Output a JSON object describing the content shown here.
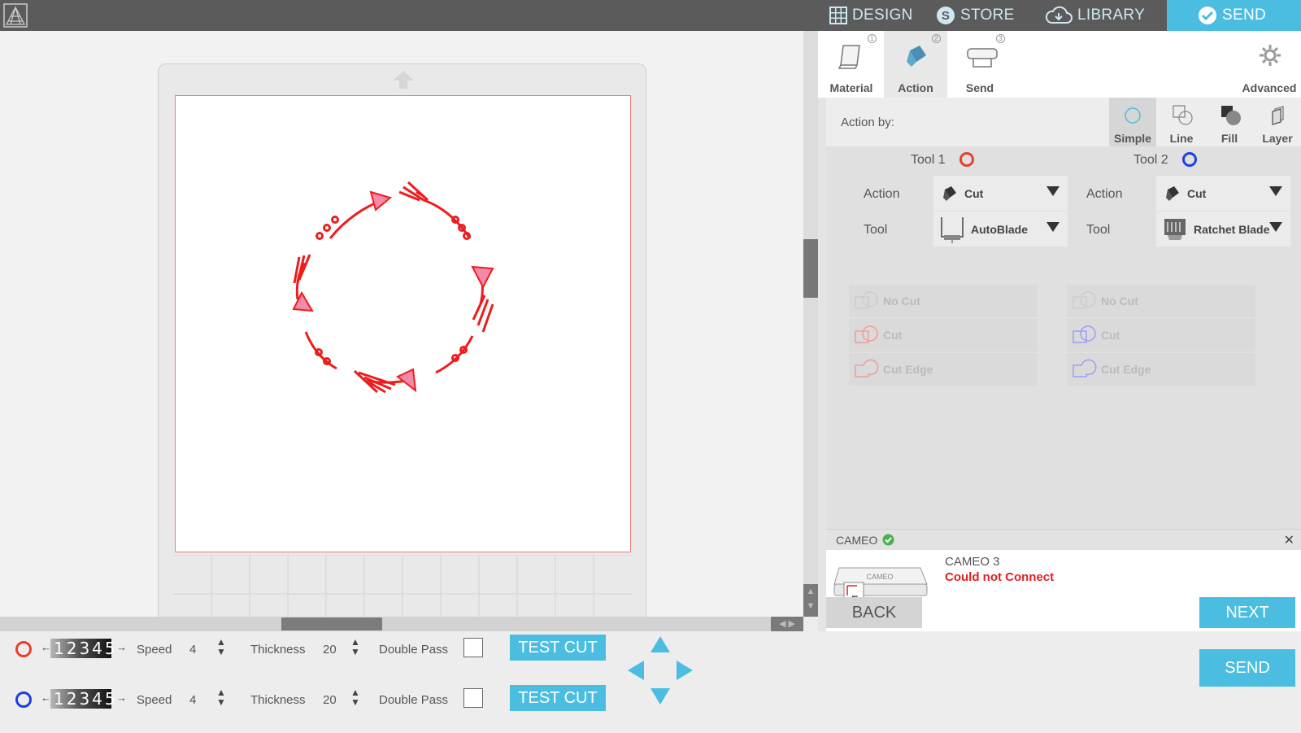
{
  "tabs": {
    "design": "DESIGN",
    "store": "STORE",
    "library": "LIBRARY",
    "send": "SEND"
  },
  "steps": [
    {
      "num": "1",
      "label": "Material"
    },
    {
      "num": "2",
      "label": "Action"
    },
    {
      "num": "3",
      "label": "Send"
    }
  ],
  "advanced_label": "Advanced",
  "action_by": {
    "label": "Action by:",
    "modes": [
      "Simple",
      "Line",
      "Fill",
      "Layer"
    ],
    "selected": "Simple"
  },
  "tool1": {
    "title": "Tool 1",
    "color": "#e8402a",
    "action_label": "Action",
    "action_value": "Cut",
    "tool_label": "Tool",
    "tool_value": "AutoBlade",
    "options": [
      "No Cut",
      "Cut",
      "Cut Edge"
    ]
  },
  "tool2": {
    "title": "Tool 2",
    "color": "#1f3ee0",
    "action_label": "Action",
    "action_value": "Cut",
    "tool_label": "Tool",
    "tool_value": "Ratchet Blade",
    "options": [
      "No Cut",
      "Cut",
      "Cut Edge"
    ]
  },
  "cameo": {
    "header": "CAMEO",
    "name": "CAMEO 3",
    "status": "Could not Connect",
    "close": "✕",
    "image_text": "CAMEO",
    "image_letter": "F"
  },
  "nav": {
    "back": "BACK",
    "next": "NEXT",
    "send": "SEND"
  },
  "bottom_rows": [
    {
      "color": "#e8402a",
      "numstrip": "12345",
      "speed_label": "Speed",
      "speed": "4",
      "thickness_label": "Thickness",
      "thickness": "20",
      "double_pass_label": "Double Pass",
      "test_cut": "TEST CUT"
    },
    {
      "color": "#1f3ee0",
      "numstrip": "12345",
      "speed_label": "Speed",
      "speed": "4",
      "thickness_label": "Thickness",
      "thickness": "20",
      "double_pass_label": "Double Pass",
      "test_cut": "TEST CUT"
    }
  ],
  "colors": {
    "accent": "#4bbde0",
    "topbar": "#5b5b5b",
    "design_stroke": "#ee1c1c",
    "design_fill": "#f48aa8"
  }
}
